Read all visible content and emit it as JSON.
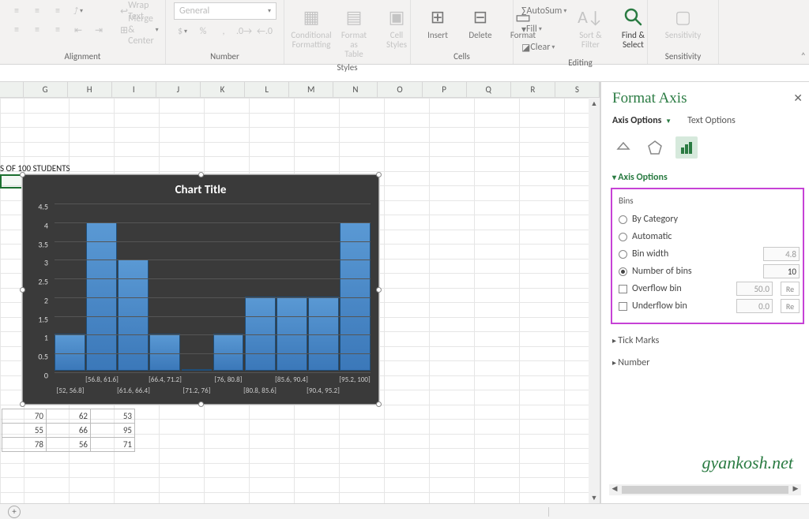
{
  "ribbon": {
    "alignment": {
      "wrap": "Wrap Text",
      "merge": "Merge & Center",
      "label": "Alignment"
    },
    "number": {
      "fmt": "General",
      "label": "Number"
    },
    "styles": {
      "cond": "Conditional\nFormatting",
      "fat": "Format as\nTable",
      "cell": "Cell\nStyles",
      "label": "Styles"
    },
    "cells": {
      "ins": "Insert",
      "del": "Delete",
      "fmt": "Format",
      "label": "Cells"
    },
    "editing": {
      "sum": "AutoSum",
      "fill": "Fill",
      "clear": "Clear",
      "sort": "Sort &\nFilter",
      "find": "Find &\nSelect",
      "label": "Editing"
    },
    "sens": {
      "btn": "Sensitivity",
      "label": "Sensitivity"
    }
  },
  "columns": [
    "",
    "G",
    "H",
    "I",
    "J",
    "K",
    "L",
    "M",
    "N",
    "O",
    "P",
    "Q",
    "R",
    "S"
  ],
  "visible_text": "S OF 100 STUDENTS",
  "table": {
    "r1": [
      "70",
      "62",
      "53"
    ],
    "r2": [
      "55",
      "66",
      "95"
    ],
    "r3": [
      "78",
      "56",
      "71"
    ]
  },
  "chart": {
    "title": "Chart Title",
    "yticks": [
      "0",
      "0.5",
      "1",
      "1.5",
      "2",
      "2.5",
      "3",
      "3.5",
      "4",
      "4.5"
    ],
    "xticks_top": [
      "[56.8, 61.6]",
      "[66.4, 71.2]",
      "[76, 80.8]",
      "[85.6, 90.4]",
      "[95.2, 100]"
    ],
    "xticks_bot": [
      "[52, 56.8]",
      "[61.6, 66.4]",
      "[71.2, 76]",
      "[80.8, 85.6]",
      "[90.4, 95.2]"
    ]
  },
  "chart_data": {
    "type": "bar",
    "subtype": "histogram",
    "title": "Chart Title",
    "categories": [
      "[52, 56.8]",
      "[56.8, 61.6]",
      "[61.6, 66.4]",
      "[66.4, 71.2]",
      "[71.2, 76]",
      "[76, 80.8]",
      "[80.8, 85.6]",
      "[85.6, 90.4]",
      "[90.4, 95.2]",
      "[95.2, 100]"
    ],
    "values": [
      1,
      4,
      3,
      1,
      0,
      1,
      2,
      2,
      2,
      4
    ],
    "ylabel": "",
    "xlabel": "",
    "ylim": [
      0,
      4.5
    ]
  },
  "pane": {
    "title": "Format Axis",
    "tab1": "Axis Options",
    "tab2": "Text Options",
    "sect_axis": "Axis Options",
    "bins_hdr": "Bins",
    "by_cat": "By Category",
    "auto": "Automatic",
    "bin_w": "Bin width",
    "bin_w_val": "4.8",
    "nbins": "Number of bins",
    "nbins_val": "10",
    "oflow": "Overflow bin",
    "oflow_val": "50.0",
    "reset1": "Re",
    "uflow": "Underflow bin",
    "uflow_val": "0.0",
    "reset2": "Re",
    "sect_ticks": "Tick Marks",
    "sect_num": "Number"
  },
  "watermark": "gyankosh.net"
}
